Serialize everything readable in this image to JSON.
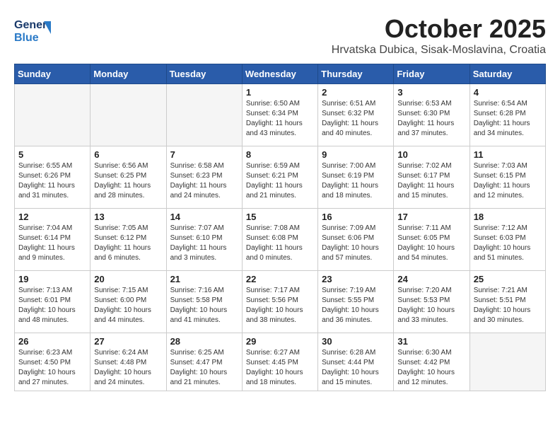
{
  "header": {
    "logo_general": "General",
    "logo_blue": "Blue",
    "month": "October 2025",
    "location": "Hrvatska Dubica, Sisak-Moslavina, Croatia"
  },
  "weekdays": [
    "Sunday",
    "Monday",
    "Tuesday",
    "Wednesday",
    "Thursday",
    "Friday",
    "Saturday"
  ],
  "weeks": [
    [
      {
        "day": "",
        "info": ""
      },
      {
        "day": "",
        "info": ""
      },
      {
        "day": "",
        "info": ""
      },
      {
        "day": "1",
        "info": "Sunrise: 6:50 AM\nSunset: 6:34 PM\nDaylight: 11 hours\nand 43 minutes."
      },
      {
        "day": "2",
        "info": "Sunrise: 6:51 AM\nSunset: 6:32 PM\nDaylight: 11 hours\nand 40 minutes."
      },
      {
        "day": "3",
        "info": "Sunrise: 6:53 AM\nSunset: 6:30 PM\nDaylight: 11 hours\nand 37 minutes."
      },
      {
        "day": "4",
        "info": "Sunrise: 6:54 AM\nSunset: 6:28 PM\nDaylight: 11 hours\nand 34 minutes."
      }
    ],
    [
      {
        "day": "5",
        "info": "Sunrise: 6:55 AM\nSunset: 6:26 PM\nDaylight: 11 hours\nand 31 minutes."
      },
      {
        "day": "6",
        "info": "Sunrise: 6:56 AM\nSunset: 6:25 PM\nDaylight: 11 hours\nand 28 minutes."
      },
      {
        "day": "7",
        "info": "Sunrise: 6:58 AM\nSunset: 6:23 PM\nDaylight: 11 hours\nand 24 minutes."
      },
      {
        "day": "8",
        "info": "Sunrise: 6:59 AM\nSunset: 6:21 PM\nDaylight: 11 hours\nand 21 minutes."
      },
      {
        "day": "9",
        "info": "Sunrise: 7:00 AM\nSunset: 6:19 PM\nDaylight: 11 hours\nand 18 minutes."
      },
      {
        "day": "10",
        "info": "Sunrise: 7:02 AM\nSunset: 6:17 PM\nDaylight: 11 hours\nand 15 minutes."
      },
      {
        "day": "11",
        "info": "Sunrise: 7:03 AM\nSunset: 6:15 PM\nDaylight: 11 hours\nand 12 minutes."
      }
    ],
    [
      {
        "day": "12",
        "info": "Sunrise: 7:04 AM\nSunset: 6:14 PM\nDaylight: 11 hours\nand 9 minutes."
      },
      {
        "day": "13",
        "info": "Sunrise: 7:05 AM\nSunset: 6:12 PM\nDaylight: 11 hours\nand 6 minutes."
      },
      {
        "day": "14",
        "info": "Sunrise: 7:07 AM\nSunset: 6:10 PM\nDaylight: 11 hours\nand 3 minutes."
      },
      {
        "day": "15",
        "info": "Sunrise: 7:08 AM\nSunset: 6:08 PM\nDaylight: 11 hours\nand 0 minutes."
      },
      {
        "day": "16",
        "info": "Sunrise: 7:09 AM\nSunset: 6:06 PM\nDaylight: 10 hours\nand 57 minutes."
      },
      {
        "day": "17",
        "info": "Sunrise: 7:11 AM\nSunset: 6:05 PM\nDaylight: 10 hours\nand 54 minutes."
      },
      {
        "day": "18",
        "info": "Sunrise: 7:12 AM\nSunset: 6:03 PM\nDaylight: 10 hours\nand 51 minutes."
      }
    ],
    [
      {
        "day": "19",
        "info": "Sunrise: 7:13 AM\nSunset: 6:01 PM\nDaylight: 10 hours\nand 48 minutes."
      },
      {
        "day": "20",
        "info": "Sunrise: 7:15 AM\nSunset: 6:00 PM\nDaylight: 10 hours\nand 44 minutes."
      },
      {
        "day": "21",
        "info": "Sunrise: 7:16 AM\nSunset: 5:58 PM\nDaylight: 10 hours\nand 41 minutes."
      },
      {
        "day": "22",
        "info": "Sunrise: 7:17 AM\nSunset: 5:56 PM\nDaylight: 10 hours\nand 38 minutes."
      },
      {
        "day": "23",
        "info": "Sunrise: 7:19 AM\nSunset: 5:55 PM\nDaylight: 10 hours\nand 36 minutes."
      },
      {
        "day": "24",
        "info": "Sunrise: 7:20 AM\nSunset: 5:53 PM\nDaylight: 10 hours\nand 33 minutes."
      },
      {
        "day": "25",
        "info": "Sunrise: 7:21 AM\nSunset: 5:51 PM\nDaylight: 10 hours\nand 30 minutes."
      }
    ],
    [
      {
        "day": "26",
        "info": "Sunrise: 6:23 AM\nSunset: 4:50 PM\nDaylight: 10 hours\nand 27 minutes."
      },
      {
        "day": "27",
        "info": "Sunrise: 6:24 AM\nSunset: 4:48 PM\nDaylight: 10 hours\nand 24 minutes."
      },
      {
        "day": "28",
        "info": "Sunrise: 6:25 AM\nSunset: 4:47 PM\nDaylight: 10 hours\nand 21 minutes."
      },
      {
        "day": "29",
        "info": "Sunrise: 6:27 AM\nSunset: 4:45 PM\nDaylight: 10 hours\nand 18 minutes."
      },
      {
        "day": "30",
        "info": "Sunrise: 6:28 AM\nSunset: 4:44 PM\nDaylight: 10 hours\nand 15 minutes."
      },
      {
        "day": "31",
        "info": "Sunrise: 6:30 AM\nSunset: 4:42 PM\nDaylight: 10 hours\nand 12 minutes."
      },
      {
        "day": "",
        "info": ""
      }
    ]
  ]
}
